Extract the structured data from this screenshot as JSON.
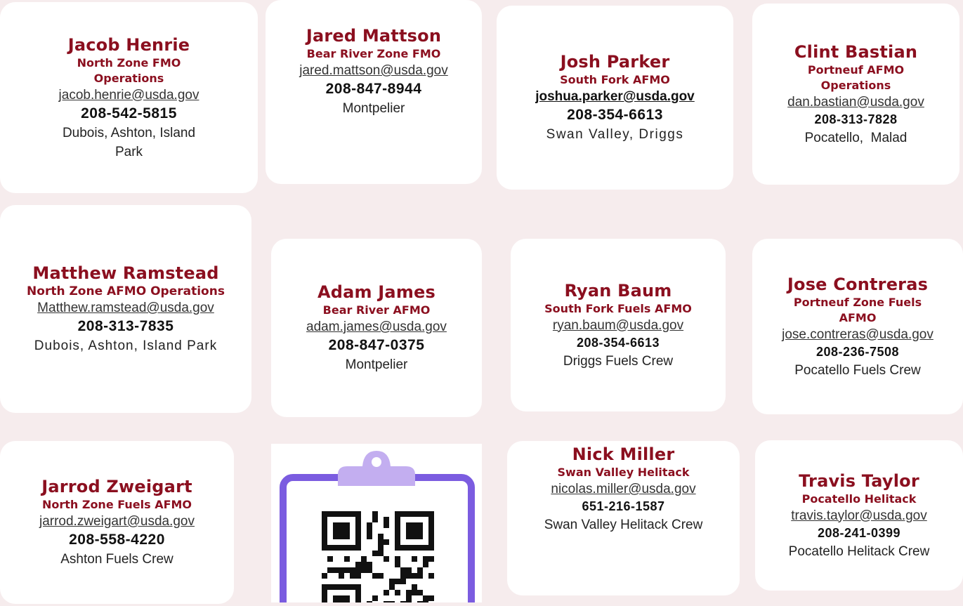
{
  "contacts": [
    {
      "name": "Jacob Henrie",
      "title": "North Zone FMO Operations",
      "email": "jacob.henrie@usda.gov",
      "phone": "208-542-5815",
      "location": "Dubois, Ashton, Island Park"
    },
    {
      "name": "Jared Mattson",
      "title": "Bear River Zone FMO",
      "email": "jared.mattson@usda.gov",
      "phone": "208-847-8944",
      "location": "Montpelier"
    },
    {
      "name": "Josh Parker",
      "title": "South Fork AFMO",
      "email": "joshua.parker@usda.gov",
      "phone": "208-354-6613",
      "location": "Swan Valley, Driggs"
    },
    {
      "name": "Clint Bastian",
      "title": "Portneuf AFMO Operations",
      "email": "dan.bastian@usda.gov",
      "phone": "208-313-7828",
      "location": "Pocatello,  Malad"
    },
    {
      "name": "Matthew Ramstead",
      "title": "North Zone AFMO Operations",
      "email": "Matthew.ramstead@usda.gov",
      "phone": "208-313-7835",
      "location": "Dubois, Ashton, Island Park"
    },
    {
      "name": "Adam James",
      "title": "Bear River AFMO",
      "email": "adam.james@usda.gov",
      "phone": "208-847-0375",
      "location": "Montpelier"
    },
    {
      "name": "Ryan Baum",
      "title": "South Fork Fuels AFMO",
      "email": "ryan.baum@usda.gov",
      "phone": "208-354-6613",
      "location": "Driggs Fuels Crew"
    },
    {
      "name": "Jose Contreras",
      "title": "Portneuf Zone Fuels AFMO",
      "email": "jose.contreras@usda.gov",
      "phone": "208-236-7508",
      "location": "Pocatello Fuels Crew"
    },
    {
      "name": "Jarrod Zweigart",
      "title": "North Zone Fuels AFMO",
      "email": "jarrod.zweigart@usda.gov",
      "phone": "208-558-4220",
      "location": "Ashton Fuels Crew"
    },
    {
      "name": "Nick Miller",
      "title": "Swan Valley Helitack",
      "email": "nicolas.miller@usda.gov",
      "phone": "651-216-1587",
      "location": "Swan Valley Helitack Crew"
    },
    {
      "name": "Travis Taylor",
      "title": "Pocatello Helitack",
      "email": "travis.taylor@usda.gov",
      "phone": "208-241-0399",
      "location": "Pocatello Helitack Crew"
    }
  ],
  "qr": {
    "icon": "clipboard-qr-code-icon",
    "frame_color": "#7b5ce0",
    "clip_color": "#c3aef0"
  },
  "colors": {
    "name": "#8b0f1f",
    "background": "#f6eced",
    "card": "#ffffff"
  }
}
